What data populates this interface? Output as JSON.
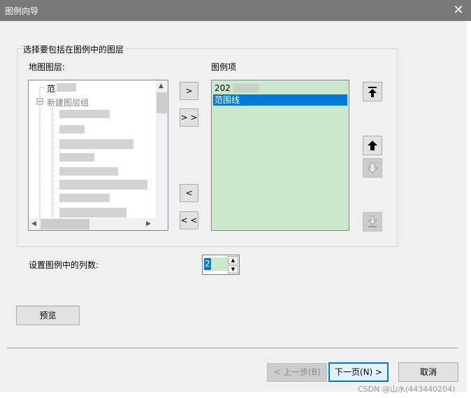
{
  "window": {
    "title": "图例向导",
    "close_glyph": "✕"
  },
  "group": {
    "caption": "选择要包括在图例中的图层"
  },
  "map_layers": {
    "label": "地图图层:",
    "items": [
      {
        "text": "范"
      },
      {
        "text": "新建图层组"
      }
    ]
  },
  "transfer_buttons": {
    "add_one": ">",
    "add_all": "> >",
    "remove_one": "<",
    "remove_all": "< <"
  },
  "legend_items": {
    "label": "图例项",
    "items": [
      {
        "text": "202",
        "selected": false
      },
      {
        "text": "范围线",
        "selected": true
      }
    ]
  },
  "order_buttons": {
    "top_icon": "move-to-top-icon",
    "up_icon": "move-up-icon",
    "down_icon": "move-down-icon",
    "bottom_icon": "move-to-bottom-icon"
  },
  "columns": {
    "label": "设置图例中的列数:",
    "value": "2"
  },
  "preview_button": "预览",
  "footer": {
    "back": "< 上一步(B)",
    "next": "下一页(N) >",
    "cancel": "取消"
  },
  "watermark": "CSDN @山水(443440204)",
  "colors": {
    "titlebar": "#787878",
    "selection": "#0078d7",
    "legend_bg": "#cce8cc",
    "dialog_bg": "#f0f0f0"
  }
}
